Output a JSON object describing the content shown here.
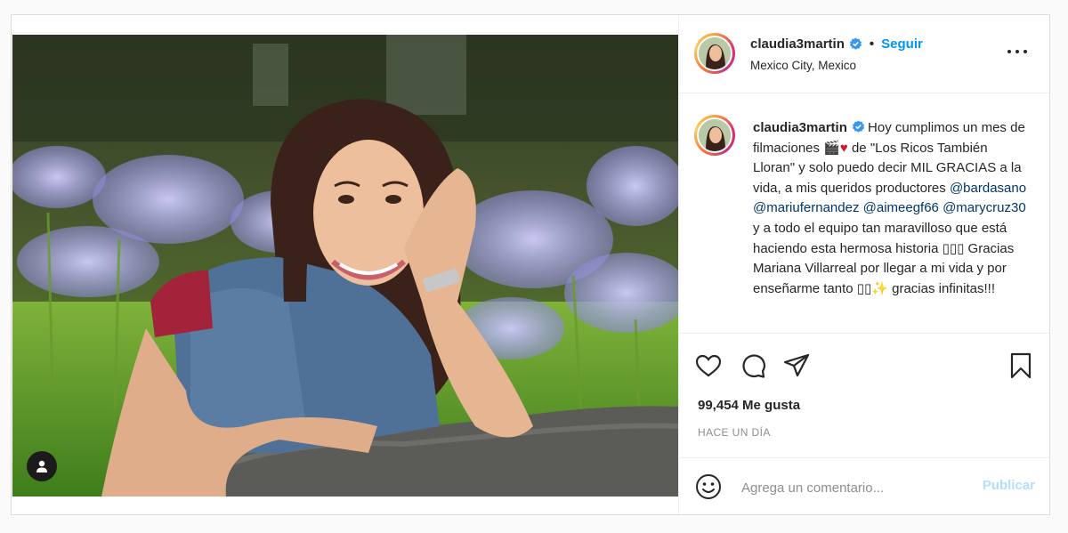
{
  "post": {
    "username": "claudia3martin",
    "verified": true,
    "separator": "•",
    "follow_label": "Seguir",
    "location": "Mexico City, Mexico"
  },
  "caption": {
    "username": "claudia3martin",
    "text_1": "Hoy cumplimos un mes de filmaciones ",
    "emoji_1": "🎬",
    "emoji_2": "♥",
    "text_2": " de \"Los Ricos También Lloran\" y solo puedo decir MIL GRACIAS a la vida, a mis queridos productores ",
    "mention_1": "@bardasano",
    "mention_2": "@mariufernandez",
    "mention_3": "@aimeegf66",
    "mention_4": "@marycruz30",
    "text_3": " y a todo el equipo tan maravilloso que está haciendo esta hermosa historia ▯▯▯ Gracias Mariana Villarreal por llegar a mi vida y por enseñarme tanto ▯▯",
    "emoji_3": "✨",
    "text_4": " gracias infinitas!!!"
  },
  "engagement": {
    "likes": "99,454 Me gusta",
    "time": "HACE UN DÍA"
  },
  "comment": {
    "placeholder": "Agrega un comentario...",
    "publish_label": "Publicar"
  },
  "icons": {
    "like": "heart-icon",
    "comment": "comment-icon",
    "share": "paper-plane-icon",
    "save": "bookmark-icon",
    "more": "more-options-icon",
    "emoji": "smiley-icon",
    "user_tag": "user-tag-icon",
    "verified": "verified-badge-icon"
  },
  "colors": {
    "link_blue": "#0095f6",
    "mention": "#00376b",
    "publish_disabled": "#b2dffc",
    "verified_badge": "#3897f0"
  }
}
